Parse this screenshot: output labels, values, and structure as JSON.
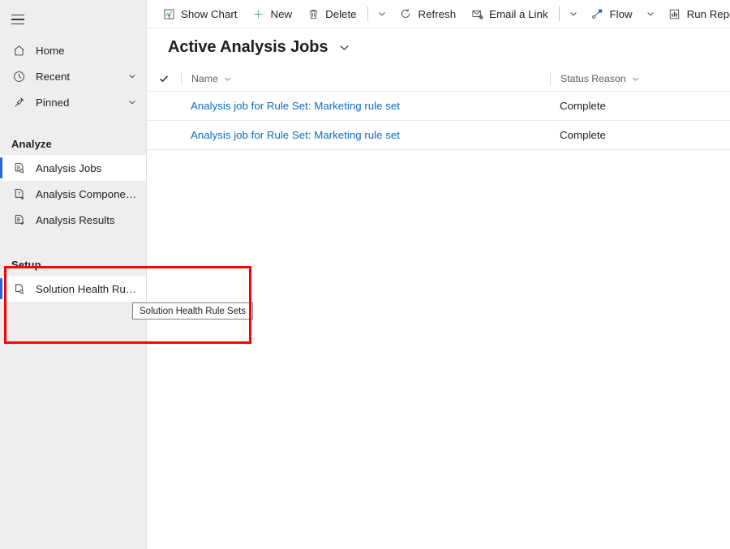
{
  "colors": {
    "accent": "#2266e3",
    "link": "#0f6cbd",
    "sidebar_bg": "#efeeee",
    "highlight_box": "#ff0000",
    "text": "#201f1e",
    "muted": "#605e5c"
  },
  "sidebar": {
    "hamburger": "hamburger-menu",
    "top_items": [
      {
        "label": "Home",
        "icon": "home-icon",
        "has_chevron": false
      },
      {
        "label": "Recent",
        "icon": "clock-icon",
        "has_chevron": true
      },
      {
        "label": "Pinned",
        "icon": "pin-icon",
        "has_chevron": true
      }
    ],
    "groups": [
      {
        "header": "Analyze",
        "items": [
          {
            "label": "Analysis Jobs",
            "icon": "document-search-icon",
            "selected": true
          },
          {
            "label": "Analysis Components",
            "icon": "document-question-icon",
            "selected": false
          },
          {
            "label": "Analysis Results",
            "icon": "document-check-icon",
            "selected": false
          }
        ]
      },
      {
        "header": "Setup",
        "items": [
          {
            "label": "Solution Health Rule ...",
            "icon": "document-magnifier-icon",
            "selected": false
          }
        ]
      }
    ],
    "tooltip": "Solution Health Rule Sets"
  },
  "commandbar": {
    "items": [
      {
        "type": "button",
        "label": "Show Chart",
        "icon": "show-chart-icon"
      },
      {
        "type": "button",
        "label": "New",
        "icon": "plus-icon"
      },
      {
        "type": "button",
        "label": "Delete",
        "icon": "trash-icon"
      },
      {
        "type": "separator"
      },
      {
        "type": "chevron",
        "label": "More commands",
        "icon": "chevron-down-icon"
      },
      {
        "type": "button",
        "label": "Refresh",
        "icon": "refresh-icon"
      },
      {
        "type": "button",
        "label": "Email a Link",
        "icon": "email-link-icon"
      },
      {
        "type": "separator"
      },
      {
        "type": "chevron",
        "label": "More email commands",
        "icon": "chevron-down-icon"
      },
      {
        "type": "button",
        "label": "Flow",
        "icon": "flow-icon"
      },
      {
        "type": "chevron",
        "label": "Flow options",
        "icon": "chevron-down-icon"
      },
      {
        "type": "button",
        "label": "Run Report",
        "icon": "run-report-icon"
      },
      {
        "type": "chevron",
        "label": "Run Report options",
        "icon": "chevron-down-icon"
      }
    ]
  },
  "page": {
    "title": "Active Analysis Jobs",
    "title_chevron": "chevron-down-icon"
  },
  "grid": {
    "select_all_icon": "checkmark-icon",
    "columns": [
      {
        "label": "Name",
        "sort_icon": "chevron-down-icon"
      },
      {
        "label": "Status Reason",
        "sort_icon": "chevron-down-icon"
      }
    ],
    "rows": [
      {
        "name": "Analysis job for Rule Set: Marketing rule set",
        "status": "Complete"
      },
      {
        "name": "Analysis job for Rule Set: Marketing rule set",
        "status": "Complete"
      }
    ]
  }
}
